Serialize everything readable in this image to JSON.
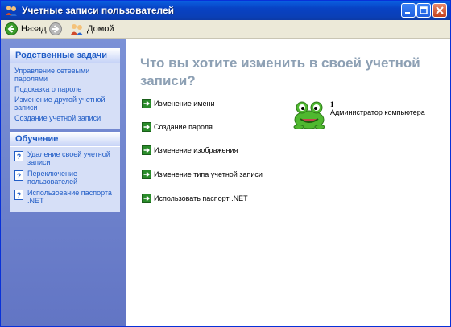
{
  "window": {
    "title": "Учетные записи пользователей"
  },
  "toolbar": {
    "back_label": "Назад",
    "home_label": "Домой"
  },
  "sidebar": {
    "related": {
      "header": "Родственные задачи",
      "items": [
        "Управление сетевыми паролями",
        "Подсказка о пароле",
        "Изменение другой учетной записи",
        "Создание учетной записи"
      ]
    },
    "learn": {
      "header": "Обучение",
      "items": [
        "Удаление своей учетной записи",
        "Переключение пользователей",
        "Использование паспорта .NET"
      ]
    }
  },
  "main": {
    "heading": "Что вы хотите изменить в своей учетной записи?",
    "options": [
      "Изменение имени",
      "Создание пароля",
      "Изменение изображения",
      "Изменение типа учетной записи",
      "Использовать паспорт .NET"
    ]
  },
  "user": {
    "name": "1",
    "role": "Администратор компьютера"
  },
  "colors": {
    "titlebar": "#0a5fe0",
    "sidebar": "#7b91d6",
    "link": "#215dc6",
    "heading": "#8da0b4",
    "arrow": "#2a8c2a"
  },
  "icons": [
    "users-icon",
    "back-arrow-icon",
    "forward-arrow-icon",
    "home-users-icon",
    "help-icon",
    "green-arrow-icon",
    "frog-avatar"
  ]
}
